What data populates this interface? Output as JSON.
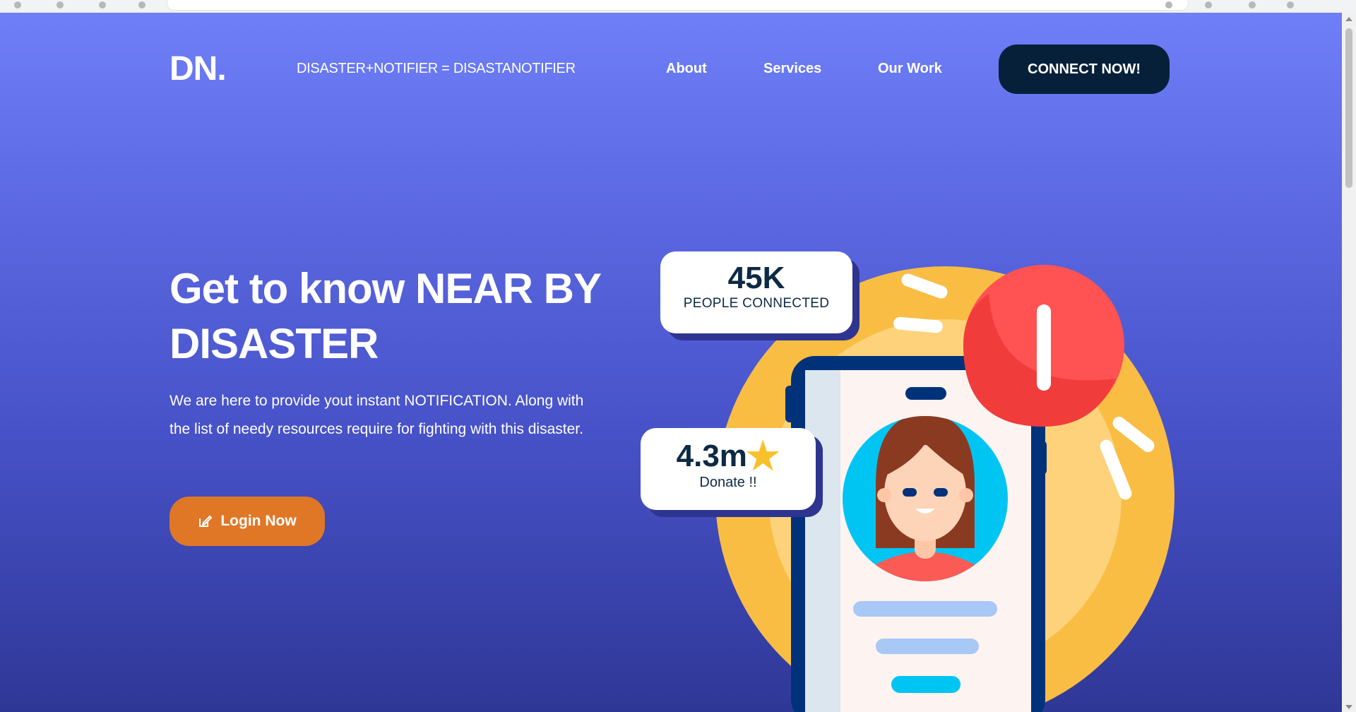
{
  "nav": {
    "logo": "DN.",
    "tagline": "DISASTER+NOTIFIER = DISASTANOTIFIER",
    "links": [
      "About",
      "Services",
      "Our Work"
    ],
    "cta": "CONNECT NOW!"
  },
  "hero": {
    "title": "Get to know NEAR BY DISASTER",
    "description": "We are here to provide yout instant NOTIFICATION. Along with the list of needy resources require for fighting with this disaster.",
    "login_label": "Login Now"
  },
  "stats": {
    "people_value": "45K",
    "people_label": "PEOPLE CONNECTED",
    "donate_value": "4.3m",
    "donate_label": "Donate !!"
  },
  "colors": {
    "accent_orange": "#e07727",
    "navy": "#07203a",
    "hero_gradient_top": "#6f7ff8",
    "hero_gradient_bottom": "#2f3796",
    "alert_red": "#ff5252",
    "sun_yellow": "#f9bd44"
  },
  "icons": {
    "login": "edit-icon",
    "donate": "star-icon",
    "alert": "exclamation-icon"
  }
}
